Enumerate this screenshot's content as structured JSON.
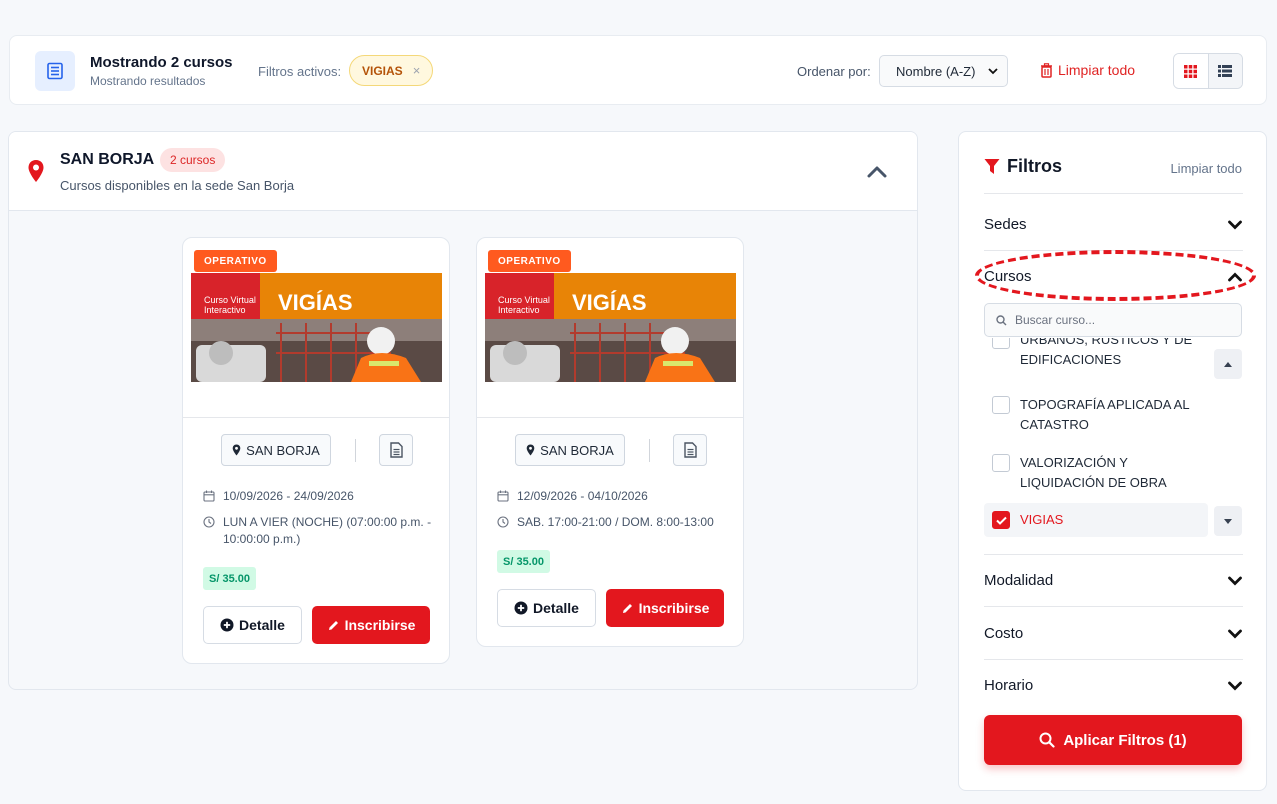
{
  "header": {
    "title": "Mostrando 2 cursos",
    "subtitle": "Mostrando resultados",
    "active_filters_label": "Filtros activos:",
    "active_filter_chip": "VIGIAS",
    "sort_label": "Ordenar por:",
    "sort_value": "Nombre (A-Z)",
    "clear_all": "Limpiar todo"
  },
  "sede": {
    "name": "SAN BORJA",
    "count": "2 cursos",
    "description": "Cursos disponibles en la sede San Borja"
  },
  "cards": [
    {
      "tag": "OPERATIVO",
      "banner_small": "Curso Virtual",
      "banner_small2": "Interactivo",
      "banner_title": "VIGÍAS",
      "location": "SAN BORJA",
      "dates": "10/09/2026 - 24/09/2026",
      "schedule": "LUN A VIER (NOCHE) (07:00:00 p.m. - 10:00:00 p.m.)",
      "price": "S/ 35.00",
      "detail_label": "Detalle",
      "enroll_label": "Inscribirse"
    },
    {
      "tag": "OPERATIVO",
      "banner_small": "Curso Virtual",
      "banner_small2": "Interactivo",
      "banner_title": "VIGÍAS",
      "location": "SAN BORJA",
      "dates": "12/09/2026 - 04/10/2026",
      "schedule": "SAB. 17:00-21:00 / DOM. 8:00-13:00",
      "price": "S/ 35.00",
      "detail_label": "Detalle",
      "enroll_label": "Inscribirse"
    }
  ],
  "sidebar": {
    "title": "Filtros",
    "clear_all": "Limpiar todo",
    "sections": {
      "sedes": "Sedes",
      "cursos": "Cursos",
      "modalidad": "Modalidad",
      "costo": "Costo",
      "horario": "Horario"
    },
    "search_placeholder": "Buscar curso...",
    "courses": [
      {
        "label": "URBANOS, RÚSTICOS Y DE EDIFICACIONES",
        "checked": false
      },
      {
        "label": "TOPOGRAFÍA APLICADA AL CATASTRO",
        "checked": false
      },
      {
        "label": "VALORIZACIÓN Y LIQUIDACIÓN DE OBRA",
        "checked": false
      },
      {
        "label": "VIGIAS",
        "checked": true
      }
    ],
    "apply_label": "Aplicar Filtros (1)"
  },
  "colors": {
    "primary_red": "#e3171e",
    "operativo_orange": "#ff5a1f",
    "chip_amber": "#b45309",
    "price_green": "#059669"
  }
}
